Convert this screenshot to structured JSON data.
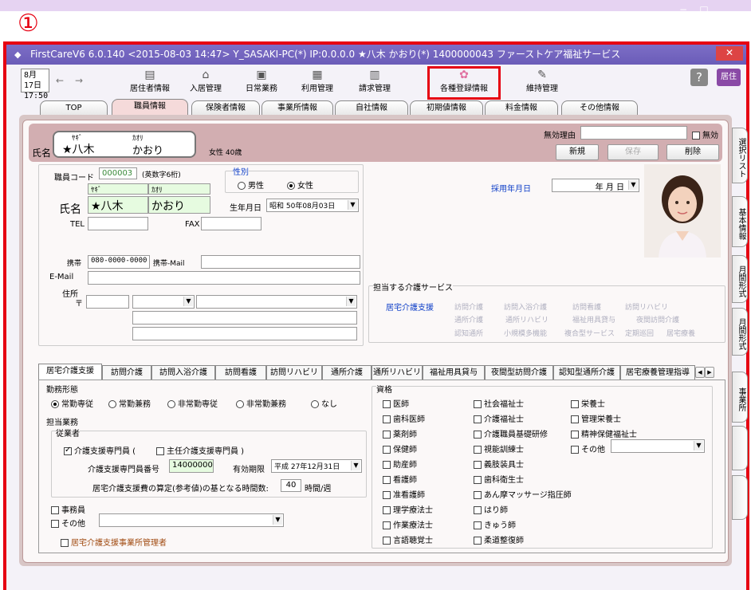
{
  "step_marker": "①",
  "titlebar": {
    "text": "FirstCareV6 6.0.140 <2015-08-03 14:47> Y_SASAKI-PC(*) IP:0.0.0.0 ★八木 かおり(*) 1400000043 ファーストケア福祉サービス"
  },
  "toolbar": {
    "date": "8月17日",
    "time": "17:50",
    "buttons": [
      "居住者情報",
      "入居管理",
      "日常業務",
      "利用管理",
      "請求管理",
      "各種登録情報",
      "維持管理"
    ],
    "help": "?",
    "right": "居住"
  },
  "tabs": [
    "TOP",
    "職員情報",
    "保険者情報",
    "事業所情報",
    "自社情報",
    "初期値情報",
    "料金情報",
    "その他情報"
  ],
  "header": {
    "label": "氏名",
    "kana_sei": "ﾔｷﾞ",
    "kana_mei": "ｶｵﾘ",
    "sei": "★八木",
    "mei": "かおり",
    "info": "女性 40歳",
    "invalid_reason_label": "無効理由",
    "invalid_label": "無効",
    "new": "新規",
    "save": "保存",
    "delete": "削除"
  },
  "side_tabs": [
    "選択リスト",
    "基本情報",
    "月間形式",
    "月間形式",
    "事業所"
  ],
  "form": {
    "code_label": "職員コード",
    "code": "000003",
    "code_hint": "(英数字6桁)",
    "gender_label": "性別",
    "male": "男性",
    "female": "女性",
    "kana_sei": "ﾔｷﾞ",
    "kana_mei": "ｶｵﾘ",
    "name_label": "氏名",
    "sei": "★八木",
    "mei": "かおり",
    "birth_label": "生年月日",
    "birth": "昭和 50年08月03日",
    "tel_label": "TEL",
    "fax_label": "FAX",
    "mobile_label": "携帯",
    "mobile": "080-0000-0000",
    "mobile_mail_label": "携帯-Mail",
    "email_label": "E-Mail",
    "address_label": "住所",
    "zip_label": "〒",
    "hire_label": "採用年月日",
    "hire": "年 月 日"
  },
  "services": {
    "label": "担当する介護サービス",
    "items": [
      "居宅介護支援",
      "訪問介護",
      "訪問入浴介護",
      "訪問看護",
      "訪問リハビリ",
      "通所介護",
      "通所リハビリ",
      "福祉用具貸与",
      "夜間訪問介護",
      "認知通所",
      "小規模多機能",
      "複合型サービス",
      "定期巡回",
      "居宅療養"
    ]
  },
  "tabs2": [
    "居宅介護支援",
    "訪問介護",
    "訪問入浴介護",
    "訪問看護",
    "訪問リハビリ",
    "通所介護",
    "通所リハビリ",
    "福祉用具貸与",
    "夜間型訪問介護",
    "認知型通所介護",
    "居宅療養管理指導"
  ],
  "work": {
    "label": "勤務形態",
    "options": [
      "常勤専従",
      "常勤兼務",
      "非常勤専従",
      "非常勤兼務",
      "なし"
    ],
    "duty_label": "担当業務",
    "staff_label": "従業者",
    "cm_label": "介護支援専門員 (",
    "chief_label": "主任介護支援専門員 )",
    "cm_no_label": "介護支援専門員番号",
    "cm_no": "14000000",
    "valid_label": "有効期限",
    "valid": "平成 27年12月31日",
    "hours_label": "居宅介護支援費の算定(参考値)の基となる時間数:",
    "hours": "40",
    "hours_unit": "時間/週",
    "clerk": "事務員",
    "other": "その他",
    "manager": "居宅介護支援事業所管理者"
  },
  "qual": {
    "label": "資格",
    "col1": [
      "医師",
      "歯科医師",
      "薬剤師",
      "保健師",
      "助産師",
      "看護師",
      "准看護師",
      "理学療法士",
      "作業療法士",
      "言語聴覚士"
    ],
    "col2": [
      "社会福祉士",
      "介護福祉士",
      "介護職員基礎研修",
      "視能訓練士",
      "義肢装具士",
      "歯科衛生士",
      "あん摩マッサージ指圧師",
      "はり師",
      "きゅう師",
      "柔道整復師"
    ],
    "col3": [
      "栄養士",
      "管理栄養士",
      "精神保健福祉士",
      "その他"
    ]
  }
}
